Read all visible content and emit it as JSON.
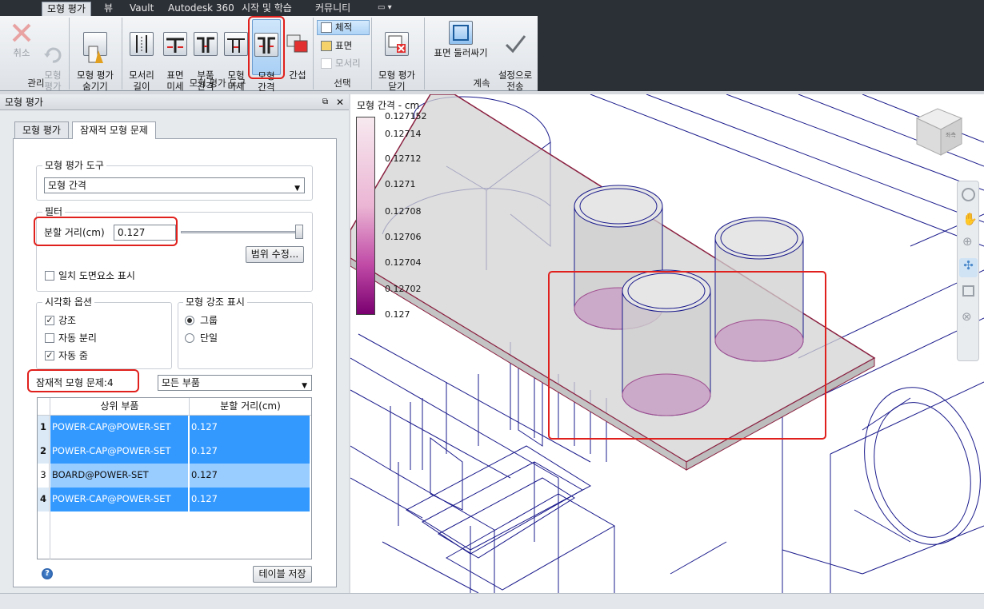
{
  "tabs": [
    "모형 평가",
    "뷰",
    "Vault",
    "Autodesk 360",
    "시작 및 학습",
    "커뮤니티"
  ],
  "ribbon": {
    "manage": {
      "cancel": "취소",
      "model_eval": "모형\n평가",
      "label": "관리"
    },
    "hide": "모형 평가\n숨기기",
    "tools_label": "모형 평가 도구",
    "tools": [
      "모서리\n길이",
      "표면\n미세",
      "부품\n간격",
      "모형\n미세",
      "모형\n간격",
      "간섭"
    ],
    "select_label": "선택",
    "select_items": [
      "체적",
      "표면",
      "모서리"
    ],
    "close": "모형 평가\n닫기",
    "continue_label": "계속",
    "surface_wrap": "표면 둘러싸기",
    "send_settings": "설정으로\n전송"
  },
  "panel": {
    "title": "모형 평가",
    "close": "✕",
    "tabs": [
      "모형 평가",
      "잠재적 모형 문제"
    ],
    "tool_group": "모형 평가 도구",
    "tool_selected": "모형 간격",
    "filter_group": "필터",
    "split_label": "분할 거리(cm)",
    "split_value": "0.127",
    "range_button": "범위 수정...",
    "show_match": "일치 도면요소 표시",
    "vis_group": "시각화 옵션",
    "vis_options": [
      {
        "label": "강조",
        "checked": true
      },
      {
        "label": "자동 분리",
        "checked": false
      },
      {
        "label": "자동 줌",
        "checked": true
      }
    ],
    "highlight_group": "모형 강조 표시",
    "highlight_options": [
      {
        "label": "그룹",
        "selected": true
      },
      {
        "label": "단일",
        "selected": false
      }
    ],
    "issues_label": "잠재적 모형 문제:",
    "issues_count": "4",
    "filter_combo": "모든 부품",
    "table_headers": [
      "상위 부품",
      "분할 거리(cm)"
    ],
    "rows": [
      {
        "n": "1",
        "part": "POWER-CAP@POWER-SET",
        "dist": "0.127"
      },
      {
        "n": "2",
        "part": "POWER-CAP@POWER-SET",
        "dist": "0.127"
      },
      {
        "n": "3",
        "part": "BOARD@POWER-SET",
        "dist": "0.127"
      },
      {
        "n": "4",
        "part": "POWER-CAP@POWER-SET",
        "dist": "0.127"
      }
    ],
    "save_table": "테이블 저장",
    "help": "?"
  },
  "legend": {
    "title": "모형 간격 - cm",
    "ticks": [
      "0.127152",
      "0.12714",
      "0.12712",
      "0.1271",
      "0.12708",
      "0.12706",
      "0.12704",
      "0.12702",
      "0.127"
    ]
  },
  "viewcube": {
    "label": "좌측"
  },
  "colors": {
    "accent": "#3399ff",
    "highlight_red": "#e0201c",
    "legend_top": "#f7e9ef",
    "legend_bottom": "#7a0070",
    "wire": "#1a1a8c"
  }
}
